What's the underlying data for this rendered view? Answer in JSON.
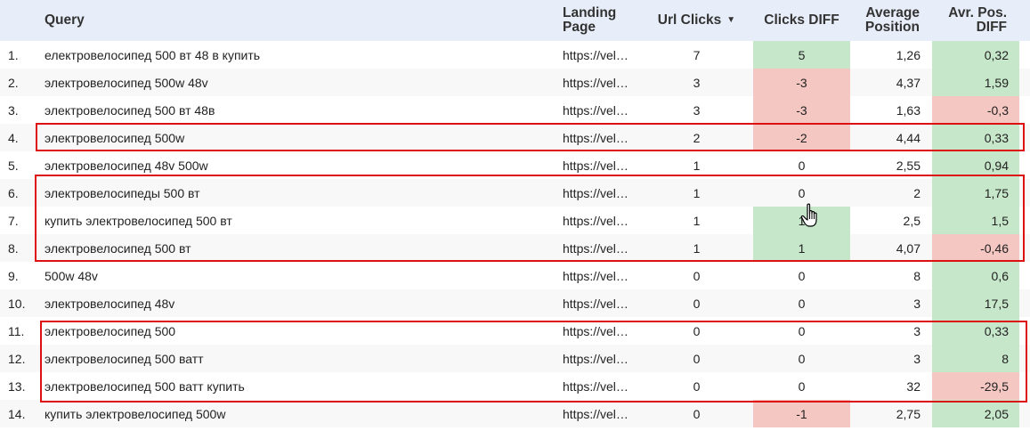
{
  "headers": {
    "index": "",
    "query": "Query",
    "landing_page_line1": "Landing",
    "landing_page_line2": "Page",
    "url_clicks": "Url Clicks",
    "url_clicks_sort_icon": "caret-down-icon",
    "clicks_diff": "Clicks DIFF",
    "average_position_line1": "Average",
    "average_position_line2": "Position",
    "avr_pos_diff_line1": "Avr. Pos.",
    "avr_pos_diff_line2": "DIFF"
  },
  "colors": {
    "header_bg": "#e8eef9",
    "positive": "#c6e7c9",
    "negative": "#f5c7c2",
    "highlight": "#d11111"
  },
  "rows": [
    {
      "idx": "1.",
      "query": "електровелосипед 500 вт 48 в купить",
      "landing": "https://vel…",
      "clicks": "7",
      "diff": "5",
      "diff_sign": "pos",
      "pos": "1,26",
      "pos_diff": "0,32",
      "pos_diff_sign": "pos"
    },
    {
      "idx": "2.",
      "query": "электровелосипед 500w 48v",
      "landing": "https://vel…",
      "clicks": "3",
      "diff": "-3",
      "diff_sign": "neg",
      "pos": "4,37",
      "pos_diff": "1,59",
      "pos_diff_sign": "pos"
    },
    {
      "idx": "3.",
      "query": "электровелосипед 500 вт 48в",
      "landing": "https://vel…",
      "clicks": "3",
      "diff": "-3",
      "diff_sign": "neg",
      "pos": "1,63",
      "pos_diff": "-0,3",
      "pos_diff_sign": "neg"
    },
    {
      "idx": "4.",
      "query": "электровелосипед 500w",
      "landing": "https://vel…",
      "clicks": "2",
      "diff": "-2",
      "diff_sign": "neg",
      "pos": "4,44",
      "pos_diff": "0,33",
      "pos_diff_sign": "pos"
    },
    {
      "idx": "5.",
      "query": "электровелосипед 48v 500w",
      "landing": "https://vel…",
      "clicks": "1",
      "diff": "0",
      "diff_sign": "none",
      "pos": "2,55",
      "pos_diff": "0,94",
      "pos_diff_sign": "pos"
    },
    {
      "idx": "6.",
      "query": "электровелосипеды 500 вт",
      "landing": "https://vel…",
      "clicks": "1",
      "diff": "0",
      "diff_sign": "none",
      "pos": "2",
      "pos_diff": "1,75",
      "pos_diff_sign": "pos"
    },
    {
      "idx": "7.",
      "query": "купить электровелосипед 500 вт",
      "landing": "https://vel…",
      "clicks": "1",
      "diff": "1",
      "diff_sign": "pos",
      "pos": "2,5",
      "pos_diff": "1,5",
      "pos_diff_sign": "pos"
    },
    {
      "idx": "8.",
      "query": "электровелосипед 500 вт",
      "landing": "https://vel…",
      "clicks": "1",
      "diff": "1",
      "diff_sign": "pos",
      "pos": "4,07",
      "pos_diff": "-0,46",
      "pos_diff_sign": "neg"
    },
    {
      "idx": "9.",
      "query": "500w 48v",
      "landing": "https://vel…",
      "clicks": "0",
      "diff": "0",
      "diff_sign": "none",
      "pos": "8",
      "pos_diff": "0,6",
      "pos_diff_sign": "pos"
    },
    {
      "idx": "10.",
      "query": "электровелосипед 48v",
      "landing": "https://vel…",
      "clicks": "0",
      "diff": "0",
      "diff_sign": "none",
      "pos": "3",
      "pos_diff": "17,5",
      "pos_diff_sign": "pos"
    },
    {
      "idx": "11.",
      "query": "электровелосипед 500",
      "landing": "https://vel…",
      "clicks": "0",
      "diff": "0",
      "diff_sign": "none",
      "pos": "3",
      "pos_diff": "0,33",
      "pos_diff_sign": "pos"
    },
    {
      "idx": "12.",
      "query": "электровелосипед 500 ватт",
      "landing": "https://vel…",
      "clicks": "0",
      "diff": "0",
      "diff_sign": "none",
      "pos": "3",
      "pos_diff": "8",
      "pos_diff_sign": "pos"
    },
    {
      "idx": "13.",
      "query": "электровелосипед 500 ватт купить",
      "landing": "https://vel…",
      "clicks": "0",
      "diff": "0",
      "diff_sign": "none",
      "pos": "32",
      "pos_diff": "-29,5",
      "pos_diff_sign": "neg"
    },
    {
      "idx": "14.",
      "query": "купить электровелосипед 500w",
      "landing": "https://vel…",
      "clicks": "0",
      "diff": "-1",
      "diff_sign": "neg",
      "pos": "2,75",
      "pos_diff": "2,05",
      "pos_diff_sign": "pos"
    }
  ],
  "cursor_icon": "hand-pointer-icon"
}
